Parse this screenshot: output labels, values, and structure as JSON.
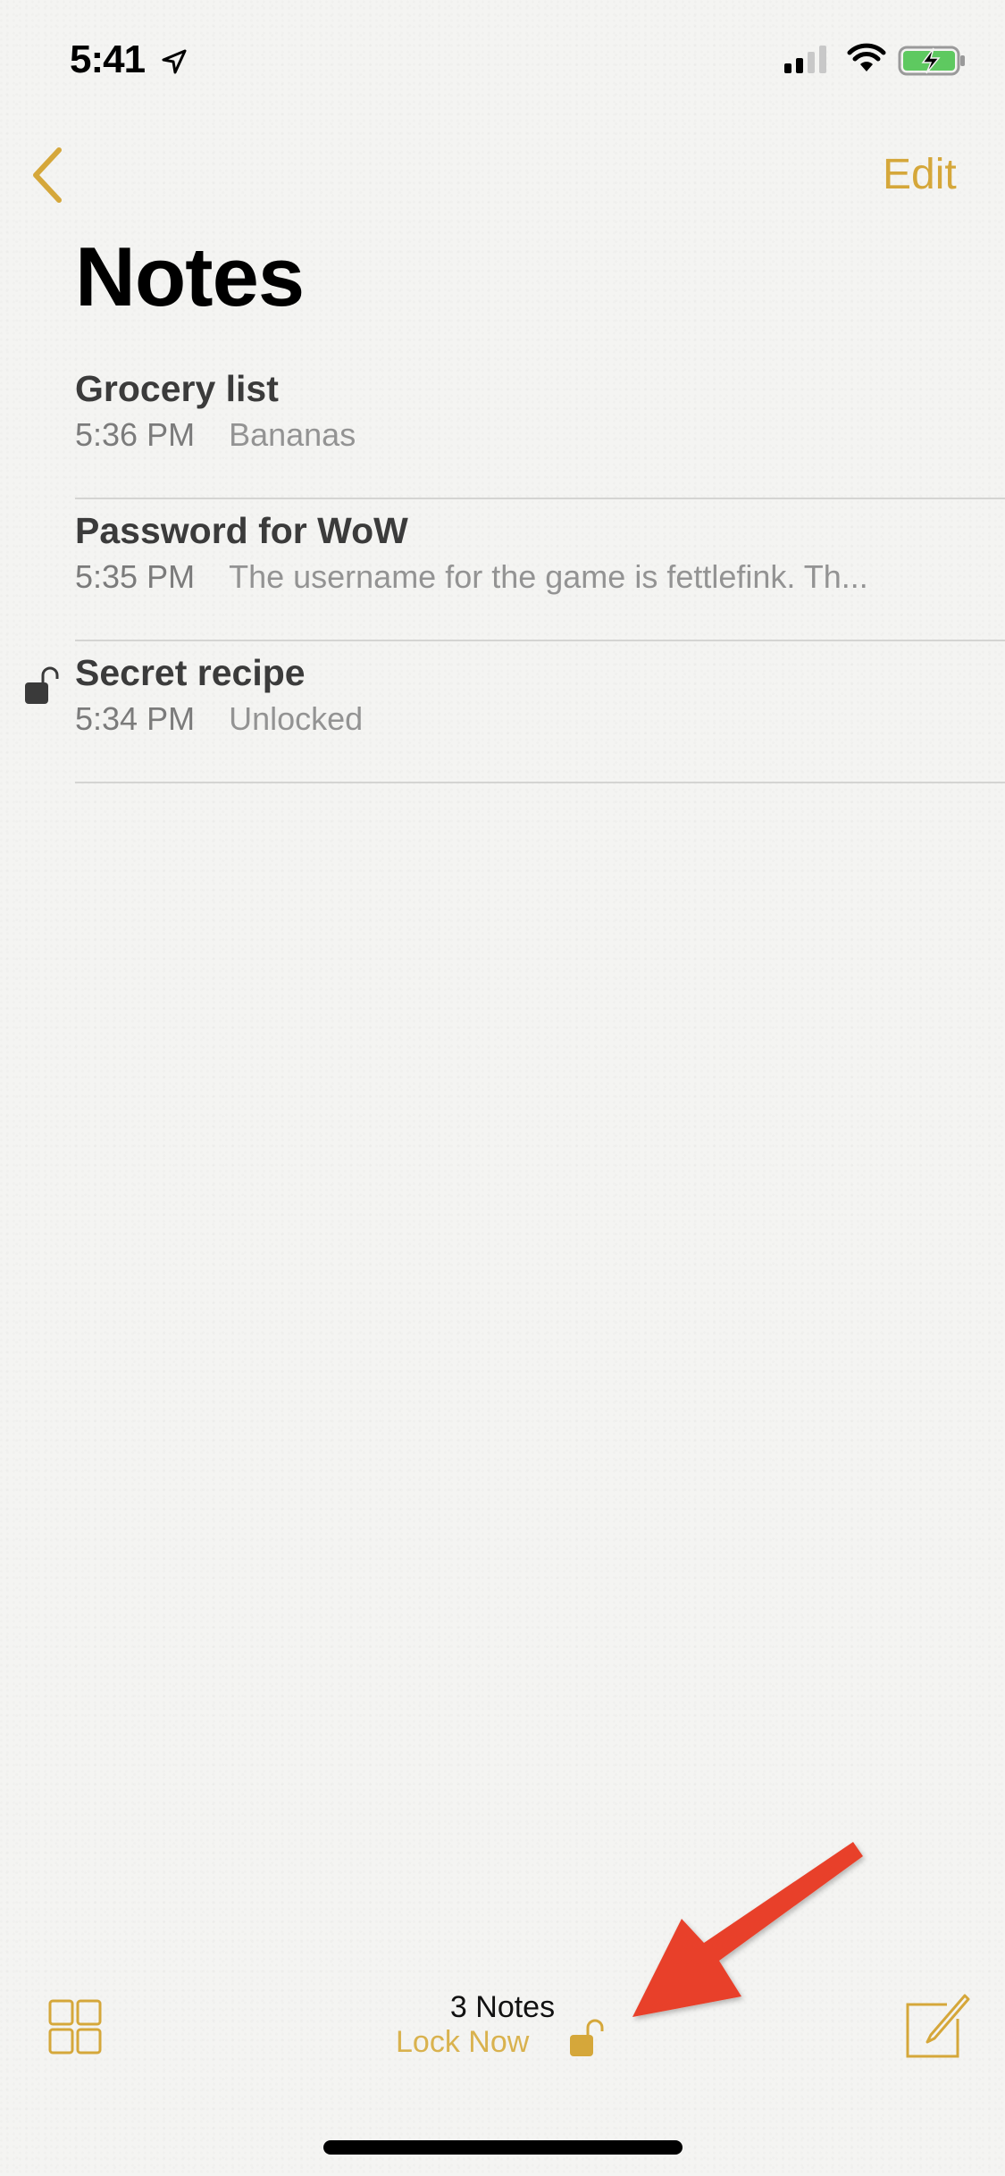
{
  "status_bar": {
    "time": "5:41",
    "location_icon": "location-arrow-icon",
    "signal_icon": "cellular-signal-icon",
    "signal_bars_active": 2,
    "signal_bars_total": 4,
    "wifi_icon": "wifi-icon",
    "battery_icon": "battery-charging-icon",
    "battery_color": "#5ec960"
  },
  "nav": {
    "back_icon": "chevron-left-icon",
    "edit_label": "Edit",
    "title": "Notes"
  },
  "notes": [
    {
      "title": "Grocery list",
      "time": "5:36 PM",
      "preview": "Bananas",
      "locked_icon": null
    },
    {
      "title": "Password for WoW",
      "time": "5:35 PM",
      "preview": "The username for the game is fettlefink. Th...",
      "locked_icon": null
    },
    {
      "title": "Secret recipe",
      "time": "5:34 PM",
      "preview": "Unlocked",
      "locked_icon": "unlocked-padlock-icon"
    }
  ],
  "toolbar": {
    "folders_icon": "folders-grid-icon",
    "note_count": "3 Notes",
    "lock_now_label": "Lock Now",
    "lock_now_icon": "unlocked-padlock-icon",
    "compose_icon": "compose-icon"
  },
  "annotation": {
    "arrow_icon": "red-arrow-pointer",
    "color": "#e8412a"
  },
  "colors": {
    "accent": "#d5a73a",
    "background": "#f4f4f2",
    "title_text": "#3b3b3b",
    "secondary_text": "#8a8a8a"
  }
}
